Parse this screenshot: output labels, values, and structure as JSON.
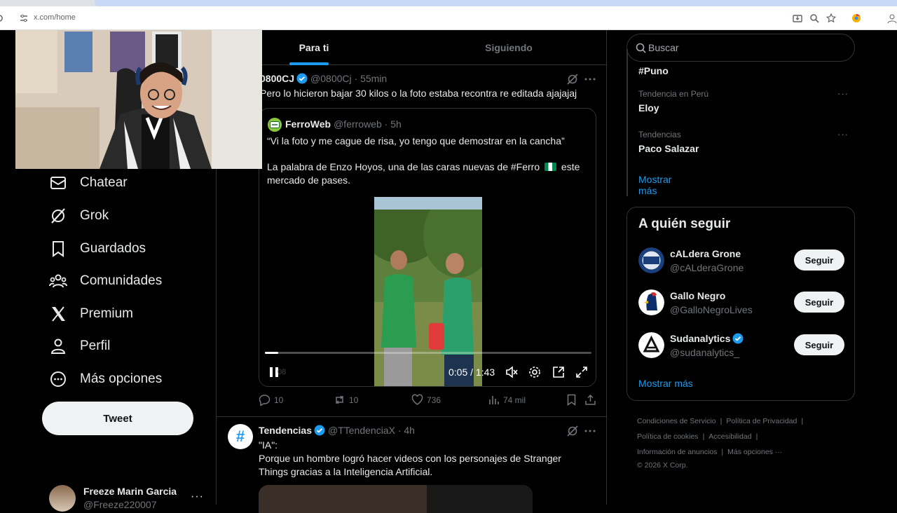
{
  "browser": {
    "url": "x.com/home"
  },
  "nav": {
    "items": [
      {
        "label": "Chatear",
        "icon": "mail-icon"
      },
      {
        "label": "Grok",
        "icon": "grok-icon"
      },
      {
        "label": "Guardados",
        "icon": "bookmark-icon"
      },
      {
        "label": "Comunidades",
        "icon": "communities-icon"
      },
      {
        "label": "Premium",
        "icon": "x-logo-icon"
      },
      {
        "label": "Perfil",
        "icon": "profile-icon"
      },
      {
        "label": "Más opciones",
        "icon": "more-circle-icon"
      }
    ],
    "tweet_button": "Tweet",
    "account": {
      "name": "Freeze Marin Garcia",
      "handle": "@Freeze220007",
      "more": "···"
    }
  },
  "timeline": {
    "tabs": [
      {
        "label": "Para ti"
      },
      {
        "label": "Siguiendo"
      }
    ],
    "post1": {
      "name": "0800CJ",
      "handle_time": "@0800Cj · 55min",
      "text": "Pero lo hicieron bajar 30 kilos o la foto estaba recontra re editada ajajajaj",
      "quote": {
        "name": "FerroWeb",
        "handle_time": "@ferroweb · 5h",
        "text1": "“Vi la foto y me cague de risa, yo tengo que demostrar en la cancha”",
        "text2a": "La palabra de Enzo Hoyos, una de las caras nuevas de #Ferro",
        "text2b": "este",
        "text3": "mercado de pases.",
        "video": {
          "time": "0:05 / 1:43",
          "progress": 0.04,
          "ghost": "08"
        }
      },
      "replies": "10",
      "reposts": "10",
      "likes": "736",
      "views": "74 mil"
    },
    "post2": {
      "avatar": "#",
      "name": "Tendencias",
      "handle_time": "@TTendenciaX · 4h",
      "line1": "\"IA\":",
      "line2": "Porque un hombre logró hacer videos con los personajes de Stranger",
      "line3": "Things gracias a la Inteligencia Artificial."
    }
  },
  "sidebar": {
    "search_placeholder": "Buscar",
    "trends": {
      "top_partial": "#Puno",
      "items": [
        {
          "context": "Tendencia en Perú",
          "title": "Eloy"
        },
        {
          "context": "Tendencias",
          "title": "Paco Salazar"
        }
      ],
      "show_more": "Mostrar más"
    },
    "who_to_follow": {
      "title": "A quién seguir",
      "accounts": [
        {
          "name": "cALdera Grone",
          "handle": "@cALderaGrone",
          "button": "Seguir"
        },
        {
          "name": "Gallo Negro",
          "handle": "@GalloNegroLives",
          "button": "Seguir"
        },
        {
          "name": "Sudanalytics",
          "handle": "@sudanalytics_",
          "button": "Seguir"
        }
      ],
      "show_more": "Mostrar más"
    },
    "footer": {
      "terms": "Condiciones de Servicio",
      "privacy": "Política de Privacidad",
      "cookies": "Política de cookies",
      "accessibility": "Accesibilidad",
      "ads": "Información de anuncios",
      "more": "Más opciones ···",
      "copyright": "© 2026 X Corp."
    }
  },
  "colors": {
    "accent": "#1d9bf0",
    "background": "#000000",
    "border": "#2f3336",
    "secondary_text": "#71767b"
  }
}
